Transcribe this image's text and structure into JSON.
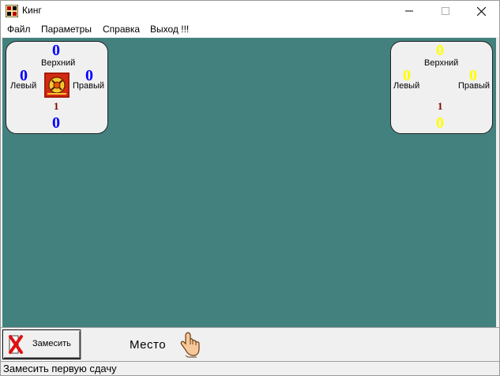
{
  "window": {
    "title": "Кинг",
    "icon": "king-app-icon"
  },
  "menu": [
    "Файл",
    "Параметры",
    "Справка",
    "Выход !!!"
  ],
  "colors": {
    "table": "#43817e",
    "player_score": "#0000ff",
    "opponent_score": "#ffff00",
    "deal_number": "#800000"
  },
  "left_panel": {
    "top_label": "Верхний",
    "left_label": "Левый",
    "right_label": "Правый",
    "top_score": "0",
    "left_score": "0",
    "right_score": "0",
    "bottom_score": "0",
    "deal_number": "1",
    "icon": "player-emblem-icon"
  },
  "right_panel": {
    "top_label": "Верхний",
    "left_label": "Левый",
    "right_label": "Правый",
    "top_score": "0",
    "left_score": "0",
    "right_score": "0",
    "bottom_score": "0",
    "deal_number": "1"
  },
  "bottom_bar": {
    "shuffle_label": "Замесить",
    "place_label": "Место"
  },
  "status": {
    "text": "Замесить первую сдачу"
  }
}
